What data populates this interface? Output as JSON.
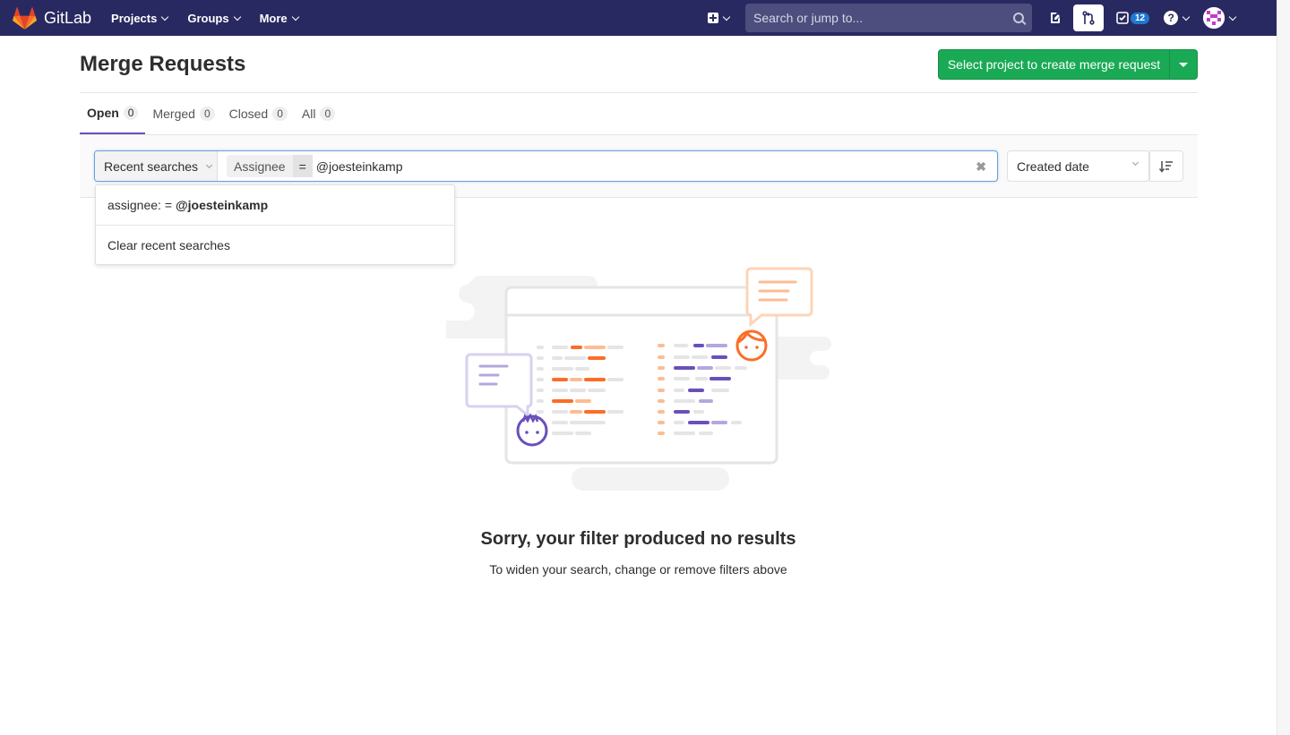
{
  "nav": {
    "brand": "GitLab",
    "items": [
      {
        "label": "Projects"
      },
      {
        "label": "Groups"
      },
      {
        "label": "More"
      }
    ],
    "search_placeholder": "Search or jump to...",
    "todos_count": "12",
    "help": "?"
  },
  "page": {
    "title": "Merge Requests",
    "create_button": "Select project to create merge request"
  },
  "tabs": [
    {
      "label": "Open",
      "count": "0",
      "active": true
    },
    {
      "label": "Merged",
      "count": "0"
    },
    {
      "label": "Closed",
      "count": "0"
    },
    {
      "label": "All",
      "count": "0"
    }
  ],
  "filter": {
    "recent_label": "Recent searches",
    "token_name": "Assignee",
    "token_operator": "=",
    "token_value": "@joesteinkamp",
    "sort_label": "Created date"
  },
  "dropdown": {
    "item_prefix": "assignee: =",
    "item_value": "@joesteinkamp",
    "clear_label": "Clear recent searches"
  },
  "empty_state": {
    "title": "Sorry, your filter produced no results",
    "subtitle": "To widen your search, change or remove filters above"
  },
  "colors": {
    "navbar": "#292961",
    "primary_green": "#1aaa55",
    "active_tab": "#6b4fbb",
    "badge_blue": "#1f78d1"
  }
}
